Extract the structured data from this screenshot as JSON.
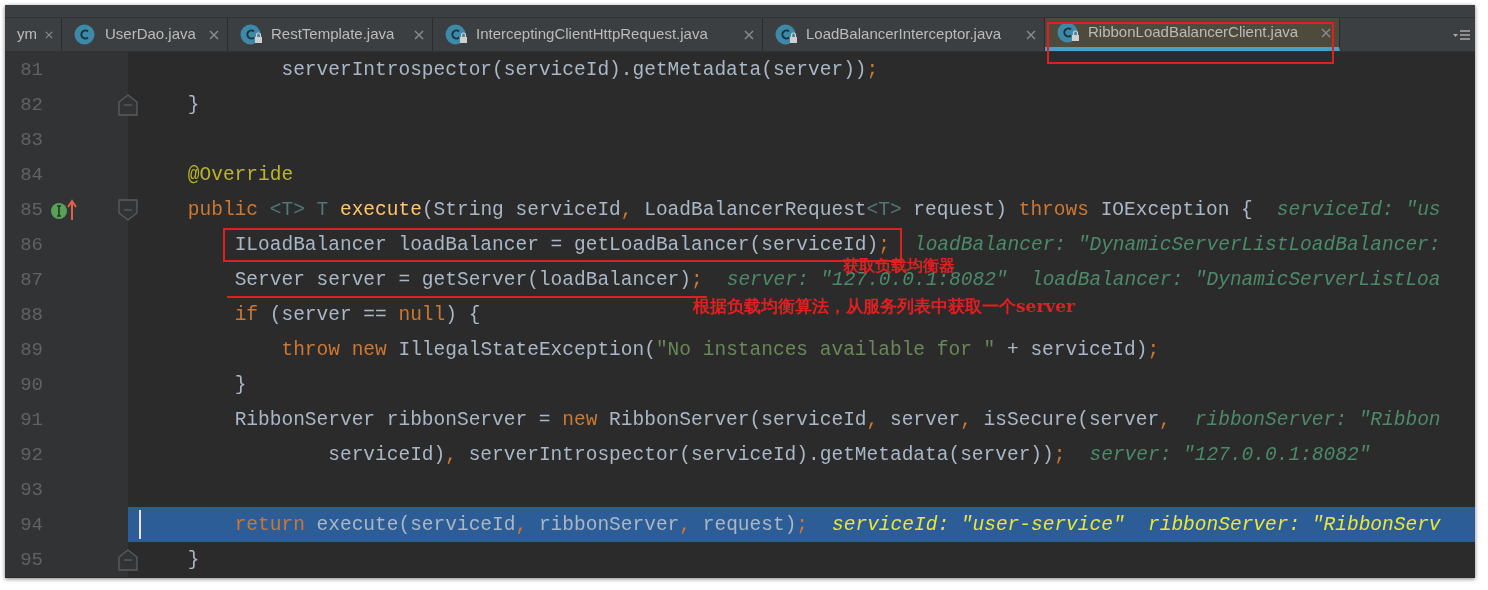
{
  "tabs": [
    {
      "label": "ym",
      "locked": false,
      "icon": false,
      "selected": false
    },
    {
      "label": "UserDao.java",
      "locked": false,
      "icon": true,
      "selected": false
    },
    {
      "label": "RestTemplate.java",
      "locked": true,
      "icon": true,
      "selected": false
    },
    {
      "label": "InterceptingClientHttpRequest.java",
      "locked": true,
      "icon": true,
      "selected": false
    },
    {
      "label": "LoadBalancerInterceptor.java",
      "locked": true,
      "icon": true,
      "selected": false
    },
    {
      "label": "RibbonLoadBalancerClient.java",
      "locked": true,
      "icon": true,
      "selected": true
    }
  ],
  "lines": [
    {
      "number": "81",
      "fold_start": false,
      "fold_end": false,
      "implements_marker": false,
      "current": false,
      "tokens": [
        {
          "kind": "plain",
          "text": "            serverIntrospector(serviceId).getMetadata(server))"
        },
        {
          "kind": "punct",
          "text": ";"
        }
      ]
    },
    {
      "number": "82",
      "fold_start": false,
      "fold_end": true,
      "implements_marker": false,
      "current": false,
      "tokens": [
        {
          "kind": "plain",
          "text": "    }"
        }
      ]
    },
    {
      "number": "83",
      "fold_start": false,
      "fold_end": false,
      "implements_marker": false,
      "current": false
    },
    {
      "number": "84",
      "fold_start": false,
      "fold_end": false,
      "implements_marker": false,
      "current": false,
      "tokens": [
        {
          "kind": "annotation",
          "text": "    @Override"
        }
      ]
    },
    {
      "number": "85",
      "fold_start": true,
      "fold_end": false,
      "implements_marker": true,
      "current": false,
      "tokens": [
        {
          "kind": "keyword",
          "text": "    public "
        },
        {
          "kind": "typeparam",
          "text": "<T> T "
        },
        {
          "kind": "method",
          "text": "execute"
        },
        {
          "kind": "plain",
          "text": "(String serviceId"
        },
        {
          "kind": "punct",
          "text": ", "
        },
        {
          "kind": "plain",
          "text": "LoadBalancerRequest"
        },
        {
          "kind": "typeparam",
          "text": "<T>"
        },
        {
          "kind": "plain",
          "text": " request) "
        },
        {
          "kind": "keyword",
          "text": "throws "
        },
        {
          "kind": "plain",
          "text": "IOException {"
        }
      ],
      "hint": "serviceId: \"us"
    },
    {
      "number": "86",
      "fold_start": false,
      "fold_end": false,
      "implements_marker": false,
      "current": false,
      "tokens": [
        {
          "kind": "plain",
          "text": "        ILoadBalancer loadBalancer = getLoadBalancer(serviceId)"
        },
        {
          "kind": "punct",
          "text": ";"
        }
      ],
      "hint": "loadBalancer: \"DynamicServerListLoadBalancer:"
    },
    {
      "number": "87",
      "fold_start": false,
      "fold_end": false,
      "implements_marker": false,
      "current": false,
      "tokens": [
        {
          "kind": "plain",
          "text": "        Server server = getServer(loadBalancer)"
        },
        {
          "kind": "punct",
          "text": ";"
        }
      ],
      "hint": "server: \"127.0.0.1:8082\"  loadBalancer: \"DynamicServerListLoa"
    },
    {
      "number": "88",
      "fold_start": false,
      "fold_end": false,
      "implements_marker": false,
      "current": false,
      "tokens": [
        {
          "kind": "keyword",
          "text": "        if "
        },
        {
          "kind": "plain",
          "text": "(server == "
        },
        {
          "kind": "keyword",
          "text": "null"
        },
        {
          "kind": "plain",
          "text": ") {"
        }
      ]
    },
    {
      "number": "89",
      "fold_start": false,
      "fold_end": false,
      "implements_marker": false,
      "current": false,
      "tokens": [
        {
          "kind": "keyword",
          "text": "            throw new "
        },
        {
          "kind": "plain",
          "text": "IllegalStateException("
        },
        {
          "kind": "string",
          "text": "\"No instances available for \""
        },
        {
          "kind": "plain",
          "text": " + serviceId)"
        },
        {
          "kind": "punct",
          "text": ";"
        }
      ]
    },
    {
      "number": "90",
      "fold_start": false,
      "fold_end": false,
      "implements_marker": false,
      "current": false,
      "tokens": [
        {
          "kind": "plain",
          "text": "        }"
        }
      ]
    },
    {
      "number": "91",
      "fold_start": false,
      "fold_end": false,
      "implements_marker": false,
      "current": false,
      "tokens": [
        {
          "kind": "plain",
          "text": "        RibbonServer ribbonServer = "
        },
        {
          "kind": "keyword",
          "text": "new "
        },
        {
          "kind": "plain",
          "text": "RibbonServer(serviceId"
        },
        {
          "kind": "punct",
          "text": ", "
        },
        {
          "kind": "plain",
          "text": "server"
        },
        {
          "kind": "punct",
          "text": ", "
        },
        {
          "kind": "plain",
          "text": "isSecure(server"
        },
        {
          "kind": "punct",
          "text": ","
        }
      ],
      "hint": "ribbonServer: \"Ribbon"
    },
    {
      "number": "92",
      "fold_start": false,
      "fold_end": false,
      "implements_marker": false,
      "current": false,
      "tokens": [
        {
          "kind": "plain",
          "text": "                serviceId)"
        },
        {
          "kind": "punct",
          "text": ", "
        },
        {
          "kind": "plain",
          "text": "serverIntrospector(serviceId).getMetadata(server))"
        },
        {
          "kind": "punct",
          "text": ";"
        }
      ],
      "hint": "server: \"127.0.0.1:8082\""
    },
    {
      "number": "93",
      "fold_start": false,
      "fold_end": false,
      "implements_marker": false,
      "current": false
    },
    {
      "number": "94",
      "fold_start": false,
      "fold_end": false,
      "implements_marker": false,
      "current": true,
      "tokens": [
        {
          "kind": "keyword",
          "text": "        return "
        },
        {
          "kind": "plain",
          "text": "execute(serviceId"
        },
        {
          "kind": "punct",
          "text": ", "
        },
        {
          "kind": "plain",
          "text": "ribbonServer"
        },
        {
          "kind": "punct",
          "text": ", "
        },
        {
          "kind": "plain",
          "text": "request)"
        },
        {
          "kind": "punct",
          "text": ";"
        }
      ],
      "hint": "serviceId: \"user-service\"  ribbonServer: \"RibbonServ"
    },
    {
      "number": "95",
      "fold_start": false,
      "fold_end": true,
      "implements_marker": false,
      "current": false,
      "tokens": [
        {
          "kind": "plain",
          "text": "    }"
        }
      ]
    }
  ],
  "annotations": [
    {
      "kind": "box"
    },
    {
      "kind": "box"
    },
    {
      "kind": "underline"
    },
    {
      "kind": "note",
      "text": "获取负载均衡器"
    },
    {
      "kind": "note",
      "text": "根据负载均衡算法，从服务列表中获取一个server"
    }
  ]
}
